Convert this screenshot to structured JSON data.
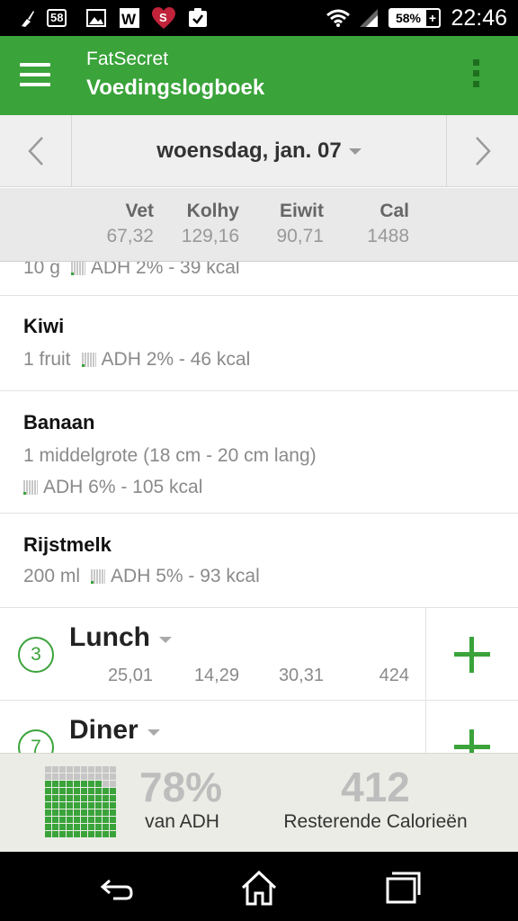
{
  "status_bar": {
    "notif_count": "58",
    "battery": "58%",
    "time": "22:46"
  },
  "app_bar": {
    "app_name": "FatSecret",
    "title": "Voedingslogboek"
  },
  "date_nav": {
    "date": "woensdag, jan. 07"
  },
  "totals": [
    {
      "label": "Vet",
      "value": "67,32"
    },
    {
      "label": "Kolhy",
      "value": "129,16"
    },
    {
      "label": "Eiwit",
      "value": "90,71"
    },
    {
      "label": "Cal",
      "value": "1488"
    }
  ],
  "food_items": [
    {
      "name": "",
      "detail_qty": "10 g",
      "detail_adh": "ADH 2% - 39 kcal"
    },
    {
      "name": "Kiwi",
      "detail_qty": "1 fruit",
      "detail_adh": "ADH 2% - 46 kcal"
    },
    {
      "name": "Banaan",
      "detail_qty": "1 middelgrote (18 cm - 20 cm lang)",
      "detail_adh": "ADH 6% - 105 kcal"
    },
    {
      "name": "Rijstmelk",
      "detail_qty": "200 ml",
      "detail_adh": "ADH 5% - 93 kcal"
    }
  ],
  "meals": [
    {
      "number": "3",
      "name": "Lunch",
      "values": [
        "25,01",
        "14,29",
        "30,31",
        "424"
      ]
    },
    {
      "number": "7",
      "name": "Diner"
    }
  ],
  "summary": {
    "adh_percent": "78%",
    "adh_label": "van ADH",
    "adh_fraction": 0.78,
    "remaining": "412",
    "remaining_label": "Resterende Calorieën"
  },
  "colors": {
    "brand_green": "#3aa33a",
    "muted_text": "#8a8a8a"
  }
}
